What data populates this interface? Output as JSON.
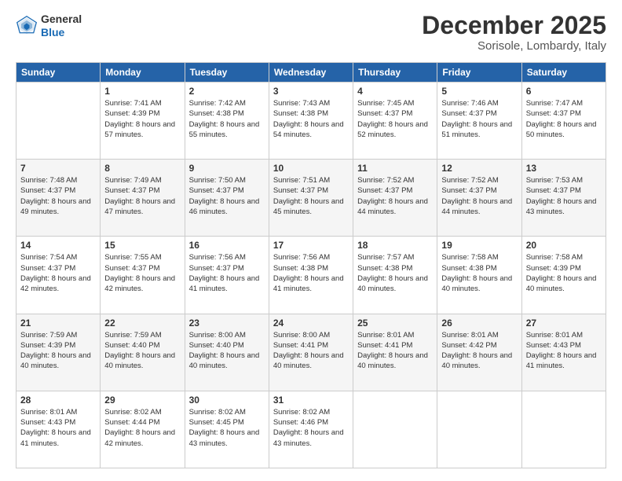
{
  "logo": {
    "general": "General",
    "blue": "Blue"
  },
  "header": {
    "month": "December 2025",
    "location": "Sorisole, Lombardy, Italy"
  },
  "weekdays": [
    "Sunday",
    "Monday",
    "Tuesday",
    "Wednesday",
    "Thursday",
    "Friday",
    "Saturday"
  ],
  "weeks": [
    [
      {
        "day": "",
        "sunrise": "",
        "sunset": "",
        "daylight": ""
      },
      {
        "day": "1",
        "sunrise": "Sunrise: 7:41 AM",
        "sunset": "Sunset: 4:39 PM",
        "daylight": "Daylight: 8 hours and 57 minutes."
      },
      {
        "day": "2",
        "sunrise": "Sunrise: 7:42 AM",
        "sunset": "Sunset: 4:38 PM",
        "daylight": "Daylight: 8 hours and 55 minutes."
      },
      {
        "day": "3",
        "sunrise": "Sunrise: 7:43 AM",
        "sunset": "Sunset: 4:38 PM",
        "daylight": "Daylight: 8 hours and 54 minutes."
      },
      {
        "day": "4",
        "sunrise": "Sunrise: 7:45 AM",
        "sunset": "Sunset: 4:37 PM",
        "daylight": "Daylight: 8 hours and 52 minutes."
      },
      {
        "day": "5",
        "sunrise": "Sunrise: 7:46 AM",
        "sunset": "Sunset: 4:37 PM",
        "daylight": "Daylight: 8 hours and 51 minutes."
      },
      {
        "day": "6",
        "sunrise": "Sunrise: 7:47 AM",
        "sunset": "Sunset: 4:37 PM",
        "daylight": "Daylight: 8 hours and 50 minutes."
      }
    ],
    [
      {
        "day": "7",
        "sunrise": "Sunrise: 7:48 AM",
        "sunset": "Sunset: 4:37 PM",
        "daylight": "Daylight: 8 hours and 49 minutes."
      },
      {
        "day": "8",
        "sunrise": "Sunrise: 7:49 AM",
        "sunset": "Sunset: 4:37 PM",
        "daylight": "Daylight: 8 hours and 47 minutes."
      },
      {
        "day": "9",
        "sunrise": "Sunrise: 7:50 AM",
        "sunset": "Sunset: 4:37 PM",
        "daylight": "Daylight: 8 hours and 46 minutes."
      },
      {
        "day": "10",
        "sunrise": "Sunrise: 7:51 AM",
        "sunset": "Sunset: 4:37 PM",
        "daylight": "Daylight: 8 hours and 45 minutes."
      },
      {
        "day": "11",
        "sunrise": "Sunrise: 7:52 AM",
        "sunset": "Sunset: 4:37 PM",
        "daylight": "Daylight: 8 hours and 44 minutes."
      },
      {
        "day": "12",
        "sunrise": "Sunrise: 7:52 AM",
        "sunset": "Sunset: 4:37 PM",
        "daylight": "Daylight: 8 hours and 44 minutes."
      },
      {
        "day": "13",
        "sunrise": "Sunrise: 7:53 AM",
        "sunset": "Sunset: 4:37 PM",
        "daylight": "Daylight: 8 hours and 43 minutes."
      }
    ],
    [
      {
        "day": "14",
        "sunrise": "Sunrise: 7:54 AM",
        "sunset": "Sunset: 4:37 PM",
        "daylight": "Daylight: 8 hours and 42 minutes."
      },
      {
        "day": "15",
        "sunrise": "Sunrise: 7:55 AM",
        "sunset": "Sunset: 4:37 PM",
        "daylight": "Daylight: 8 hours and 42 minutes."
      },
      {
        "day": "16",
        "sunrise": "Sunrise: 7:56 AM",
        "sunset": "Sunset: 4:37 PM",
        "daylight": "Daylight: 8 hours and 41 minutes."
      },
      {
        "day": "17",
        "sunrise": "Sunrise: 7:56 AM",
        "sunset": "Sunset: 4:38 PM",
        "daylight": "Daylight: 8 hours and 41 minutes."
      },
      {
        "day": "18",
        "sunrise": "Sunrise: 7:57 AM",
        "sunset": "Sunset: 4:38 PM",
        "daylight": "Daylight: 8 hours and 40 minutes."
      },
      {
        "day": "19",
        "sunrise": "Sunrise: 7:58 AM",
        "sunset": "Sunset: 4:38 PM",
        "daylight": "Daylight: 8 hours and 40 minutes."
      },
      {
        "day": "20",
        "sunrise": "Sunrise: 7:58 AM",
        "sunset": "Sunset: 4:39 PM",
        "daylight": "Daylight: 8 hours and 40 minutes."
      }
    ],
    [
      {
        "day": "21",
        "sunrise": "Sunrise: 7:59 AM",
        "sunset": "Sunset: 4:39 PM",
        "daylight": "Daylight: 8 hours and 40 minutes."
      },
      {
        "day": "22",
        "sunrise": "Sunrise: 7:59 AM",
        "sunset": "Sunset: 4:40 PM",
        "daylight": "Daylight: 8 hours and 40 minutes."
      },
      {
        "day": "23",
        "sunrise": "Sunrise: 8:00 AM",
        "sunset": "Sunset: 4:40 PM",
        "daylight": "Daylight: 8 hours and 40 minutes."
      },
      {
        "day": "24",
        "sunrise": "Sunrise: 8:00 AM",
        "sunset": "Sunset: 4:41 PM",
        "daylight": "Daylight: 8 hours and 40 minutes."
      },
      {
        "day": "25",
        "sunrise": "Sunrise: 8:01 AM",
        "sunset": "Sunset: 4:41 PM",
        "daylight": "Daylight: 8 hours and 40 minutes."
      },
      {
        "day": "26",
        "sunrise": "Sunrise: 8:01 AM",
        "sunset": "Sunset: 4:42 PM",
        "daylight": "Daylight: 8 hours and 40 minutes."
      },
      {
        "day": "27",
        "sunrise": "Sunrise: 8:01 AM",
        "sunset": "Sunset: 4:43 PM",
        "daylight": "Daylight: 8 hours and 41 minutes."
      }
    ],
    [
      {
        "day": "28",
        "sunrise": "Sunrise: 8:01 AM",
        "sunset": "Sunset: 4:43 PM",
        "daylight": "Daylight: 8 hours and 41 minutes."
      },
      {
        "day": "29",
        "sunrise": "Sunrise: 8:02 AM",
        "sunset": "Sunset: 4:44 PM",
        "daylight": "Daylight: 8 hours and 42 minutes."
      },
      {
        "day": "30",
        "sunrise": "Sunrise: 8:02 AM",
        "sunset": "Sunset: 4:45 PM",
        "daylight": "Daylight: 8 hours and 43 minutes."
      },
      {
        "day": "31",
        "sunrise": "Sunrise: 8:02 AM",
        "sunset": "Sunset: 4:46 PM",
        "daylight": "Daylight: 8 hours and 43 minutes."
      },
      {
        "day": "",
        "sunrise": "",
        "sunset": "",
        "daylight": ""
      },
      {
        "day": "",
        "sunrise": "",
        "sunset": "",
        "daylight": ""
      },
      {
        "day": "",
        "sunrise": "",
        "sunset": "",
        "daylight": ""
      }
    ]
  ]
}
